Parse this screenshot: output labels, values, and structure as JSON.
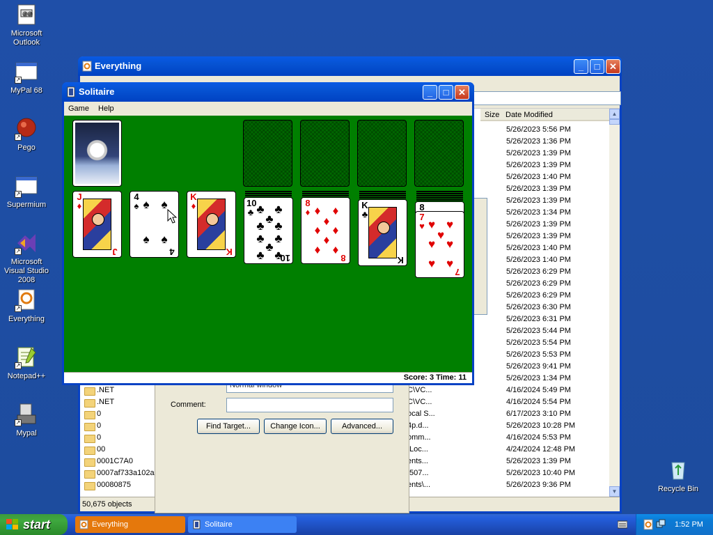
{
  "desktop_icons": [
    {
      "label": "Microsoft Outlook",
      "icon": "outlook-icon"
    },
    {
      "label": "MyPal 68",
      "icon": "mypal-icon"
    },
    {
      "label": "Pego",
      "icon": "pego-icon"
    },
    {
      "label": "Supermium",
      "icon": "supermium-icon"
    },
    {
      "label": "Microsoft Visual Studio 2008",
      "icon": "visual-studio-icon"
    },
    {
      "label": "Everything",
      "icon": "everything-icon"
    },
    {
      "label": "Notepad++",
      "icon": "notepadpp-icon"
    },
    {
      "label": "Mypal",
      "icon": "mypal-icon"
    },
    {
      "label": "Recycle Bin",
      "icon": "recycle-bin-icon"
    }
  ],
  "everything": {
    "title": "Everything",
    "columns": {
      "size": "Size",
      "date": "Date Modified"
    },
    "dates": [
      "5/26/2023 5:56 PM",
      "5/26/2023 1:36 PM",
      "5/26/2023 1:39 PM",
      "5/26/2023 1:39 PM",
      "5/26/2023 1:40 PM",
      "5/26/2023 1:39 PM",
      "5/26/2023 1:39 PM",
      "5/26/2023 1:34 PM",
      "5/26/2023 1:39 PM",
      "5/26/2023 1:39 PM",
      "5/26/2023 1:40 PM",
      "5/26/2023 1:40 PM",
      "5/26/2023 6:29 PM",
      "5/26/2023 6:29 PM",
      "5/26/2023 6:29 PM",
      "5/26/2023 6:30 PM",
      "5/26/2023 6:31 PM",
      "5/26/2023 5:44 PM",
      "5/26/2023 5:54 PM",
      "5/26/2023 5:53 PM",
      "5/26/2023 9:41 PM",
      "5/26/2023 1:34 PM",
      "4/16/2024 5:49 PM",
      "4/16/2024 5:54 PM",
      "6/17/2023 3:10 PM",
      "5/26/2023 10:28 PM",
      "4/16/2024 5:53 PM",
      "4/24/2024 12:48 PM",
      "5/26/2023 1:39 PM",
      "5/26/2023 10:40 PM",
      "5/26/2023 9:36 PM"
    ],
    "paths": [
      "C\\VC...",
      "C\\VC...",
      "ocal S...",
      "4p.d...",
      "omm...",
      "\\Loc...",
      "ents...",
      ".507...",
      "ents\\..."
    ],
    "folders": [
      ".NET",
      ".NET",
      "0",
      "0",
      "0",
      "00",
      "0001C7A0",
      "0007af733a102a5",
      "00080875"
    ],
    "status": "50,675 objects"
  },
  "properties": {
    "run_value": "Normal window",
    "comment_label": "Comment:",
    "comment_value": "",
    "buttons": {
      "find_target": "Find Target...",
      "change_icon": "Change Icon...",
      "advanced": "Advanced..."
    }
  },
  "solitaire": {
    "title": "Solitaire",
    "menu": {
      "game": "Game",
      "help": "Help"
    },
    "status": "Score: 3  Time: 11",
    "tableau": [
      {
        "rank": "J",
        "suit": "♦",
        "color": "red"
      },
      {
        "rank": "4",
        "suit": "♠",
        "color": "blk"
      },
      {
        "rank": "K",
        "suit": "♦",
        "color": "red"
      },
      {
        "rank": "10",
        "suit": "♣",
        "color": "blk"
      },
      {
        "rank": "8",
        "suit": "♦",
        "color": "red"
      },
      {
        "rank": "K",
        "suit": "♣",
        "color": "blk"
      },
      {
        "rank": "7",
        "suit": "♥",
        "color": "red",
        "under_rank": "8",
        "under_suit": "♠"
      }
    ]
  },
  "taskbar": {
    "start": "start",
    "tasks": [
      {
        "label": "Everything",
        "active": true
      },
      {
        "label": "Solitaire",
        "active": false
      }
    ],
    "clock": "1:52 PM"
  }
}
